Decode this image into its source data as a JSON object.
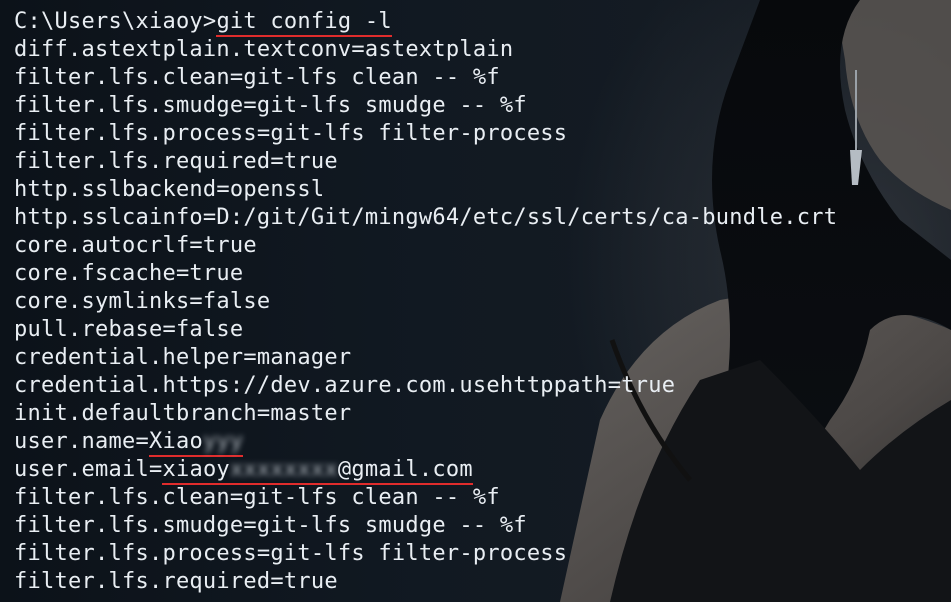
{
  "terminal": {
    "prompt": "C:\\Users\\xiaoy>",
    "command": "git config -l",
    "lines": [
      "diff.astextplain.textconv=astextplain",
      "filter.lfs.clean=git-lfs clean -- %f",
      "filter.lfs.smudge=git-lfs smudge -- %f",
      "filter.lfs.process=git-lfs filter-process",
      "filter.lfs.required=true",
      "http.sslbackend=openssl",
      "http.sslcainfo=D:/git/Git/mingw64/etc/ssl/certs/ca-bundle.crt",
      "core.autocrlf=true",
      "core.fscache=true",
      "core.symlinks=false",
      "pull.rebase=false",
      "credential.helper=manager",
      "credential.https://dev.azure.com.usehttppath=true",
      "init.defaultbranch=master"
    ],
    "user_name": {
      "key": "user.name=",
      "visible": "Xiao",
      "redacted": "yyy"
    },
    "user_email": {
      "key": "user.email=",
      "visible_start": "xiaoy",
      "redacted": "xxxxxxxx",
      "visible_end": "@gmail.com"
    },
    "lines_after": [
      "filter.lfs.clean=git-lfs clean -- %f",
      "filter.lfs.smudge=git-lfs smudge -- %f",
      "filter.lfs.process=git-lfs filter-process",
      "filter.lfs.required=true"
    ]
  },
  "colors": {
    "text": "#e9eef3",
    "annotation": "#e02c2c",
    "background": "#0e141c"
  }
}
